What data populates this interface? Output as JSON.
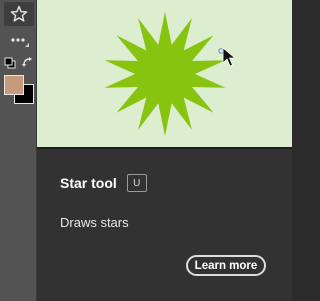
{
  "toolbar": {
    "active_tool_icon": "star-icon",
    "more_tools_icon": "ellipsis-icon",
    "default_colors_icon": "default-colors-icon",
    "swap_colors_icon": "swap-colors-icon",
    "foreground_color": "#c89a7d",
    "background_color": "#000000"
  },
  "tooltip": {
    "title": "Star tool",
    "shortcut": "U",
    "description": "Draws stars",
    "learn_more_label": "Learn more",
    "preview_background": "#dcedd0",
    "star_color": "#86c40f"
  }
}
